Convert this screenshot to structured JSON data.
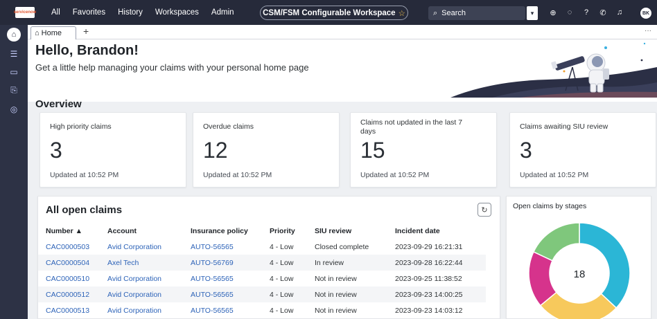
{
  "nav": {
    "logo_text": "servicenow",
    "items": [
      "All",
      "Favorites",
      "History",
      "Workspaces",
      "Admin"
    ],
    "workspace_label": "CSM/FSM Configurable Workspace",
    "search_placeholder": "Search",
    "user_initials": "BK"
  },
  "tabs": {
    "home_label": "Home"
  },
  "hero": {
    "greeting": "Hello, Brandon!",
    "subtitle": "Get a little help managing your claims with your personal home page"
  },
  "overview": {
    "title": "Overview",
    "cards": [
      {
        "label": "High priority claims",
        "value": "3",
        "updated": "Updated at 10:52 PM"
      },
      {
        "label": "Overdue claims",
        "value": "12",
        "updated": "Updated at 10:52 PM"
      },
      {
        "label": "Claims not updated in the last 7 days",
        "value": "15",
        "updated": "Updated at 10:52 PM"
      },
      {
        "label": "Claims awaiting SIU review",
        "value": "3",
        "updated": "Updated at 10:52 PM"
      }
    ]
  },
  "claims": {
    "title": "All open claims",
    "columns": [
      "Number ▲",
      "Account",
      "Insurance policy",
      "Priority",
      "SIU review",
      "Incident date"
    ],
    "rows": [
      [
        "CAC0000503",
        "Avid Corporation",
        "AUTO-56565",
        "4 - Low",
        "Closed complete",
        "2023-09-29 16:21:31"
      ],
      [
        "CAC0000504",
        "Axel Tech",
        "AUTO-56769",
        "4 - Low",
        "In review",
        "2023-09-28 16:22:44"
      ],
      [
        "CAC0000510",
        "Avid Corporation",
        "AUTO-56565",
        "4 - Low",
        "Not in review",
        "2023-09-25 11:38:52"
      ],
      [
        "CAC0000512",
        "Avid Corporation",
        "AUTO-56565",
        "4 - Low",
        "Not in review",
        "2023-09-23 14:00:25"
      ],
      [
        "CAC0000513",
        "Avid Corporation",
        "AUTO-56565",
        "4 - Low",
        "Not in review",
        "2023-09-23 14:03:12"
      ]
    ]
  },
  "stages": {
    "title": "Open claims by stages",
    "total": "18",
    "segments": [
      {
        "color": "#2bb6d6",
        "fraction": 0.37
      },
      {
        "color": "#f7c95c",
        "fraction": 0.27
      },
      {
        "color": "#d6338c",
        "fraction": 0.18
      },
      {
        "color": "#7fc77c",
        "fraction": 0.18
      }
    ]
  },
  "colors": {
    "nav_bg": "#262a3a",
    "rail_bg": "#2d3245",
    "link": "#2d63b8"
  }
}
